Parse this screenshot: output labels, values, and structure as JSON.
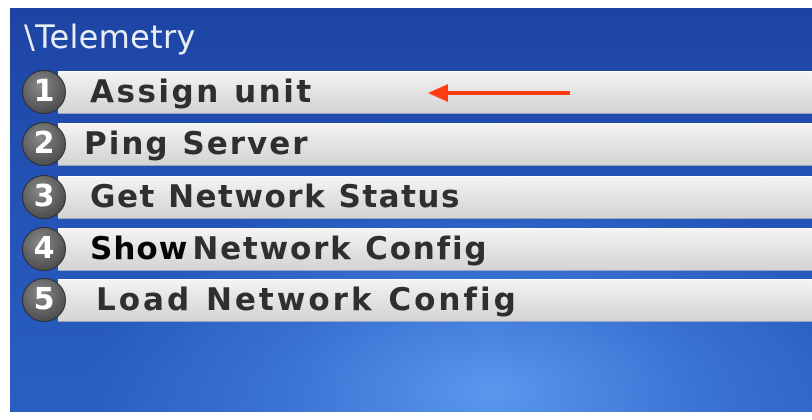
{
  "screen": {
    "title": "\\Telemetry"
  },
  "menu": {
    "items": [
      {
        "number": "1",
        "label": "Assign unit"
      },
      {
        "number": "2",
        "label": "Ping Server"
      },
      {
        "number": "3",
        "label": "Get Network Status"
      },
      {
        "number": "4",
        "label_lead": "Show",
        "label": "Network Config"
      },
      {
        "number": "5",
        "label": "Load Network Config"
      }
    ]
  },
  "annotation": {
    "arrow_icon": "left-arrow-icon",
    "arrow_color": "#ff3b10",
    "points_to": "Assign unit"
  },
  "colors": {
    "background": "#2352b5",
    "row": "#e1e1e1",
    "badge": "#5d5d5d",
    "label_text": "#2f2f2f",
    "title_text": "#e9edf5"
  }
}
